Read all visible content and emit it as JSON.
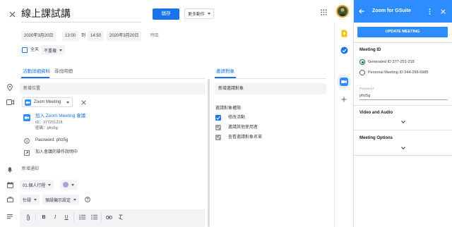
{
  "header": {
    "title": "線上課試講",
    "save_label": "儲存",
    "more_actions_label": "更多動作"
  },
  "datetime": {
    "start_date": "2020年3月20日",
    "start_time": "13:00",
    "to_label": "到",
    "end_time": "14:50",
    "end_date": "2020年3月20日",
    "timezone_label": "時區",
    "all_day_label": "全天",
    "repeat_value": "不重複"
  },
  "tabs": {
    "details": "活動詳細資料",
    "find_time": "尋找時間",
    "guests": "邀請對象"
  },
  "details": {
    "location_placeholder": "新增位置",
    "conference_value": "Zoom Meeting",
    "join_link": "加入 Zoom Meeting 會議",
    "meeting_id_line": "ID：377251218",
    "password_line": "密碼：pfrz5g",
    "password_full": "Password: pfrz5g",
    "join_instructions": "加入會議的操作說明中",
    "add_notification": "新增通知",
    "calendar_value": "01.個人行程",
    "busy_value": "忙碌",
    "visibility_value": "預設顯示設定"
  },
  "guests": {
    "add_guests_placeholder": "新增邀請對象",
    "permissions_title": "邀請對象權限",
    "permissions": [
      {
        "label": "修改活動",
        "checked": true,
        "style": "blue"
      },
      {
        "label": "邀請其他使用者",
        "checked": true,
        "style": "grey"
      },
      {
        "label": "查看邀請對象名單",
        "checked": true,
        "style": "grey"
      }
    ]
  },
  "zoom_panel": {
    "title": "Zoom for GSuite",
    "update_button": "UPDATE MEETING",
    "meeting_id_title": "Meeting ID",
    "generated_id": "Generated ID 377-251-218",
    "personal_id": "Personal Meeting ID 244-298-6985",
    "password_label": "Password",
    "password_value": "pfrz5g",
    "video_audio_title": "Video and Audio",
    "meeting_options_title": "Meeting Options"
  },
  "colors": {
    "accent": "#1a73e8",
    "zoom_blue": "#2d8cff",
    "calendar_color": "#b39ddb",
    "keep_yellow": "#fbbc04"
  }
}
